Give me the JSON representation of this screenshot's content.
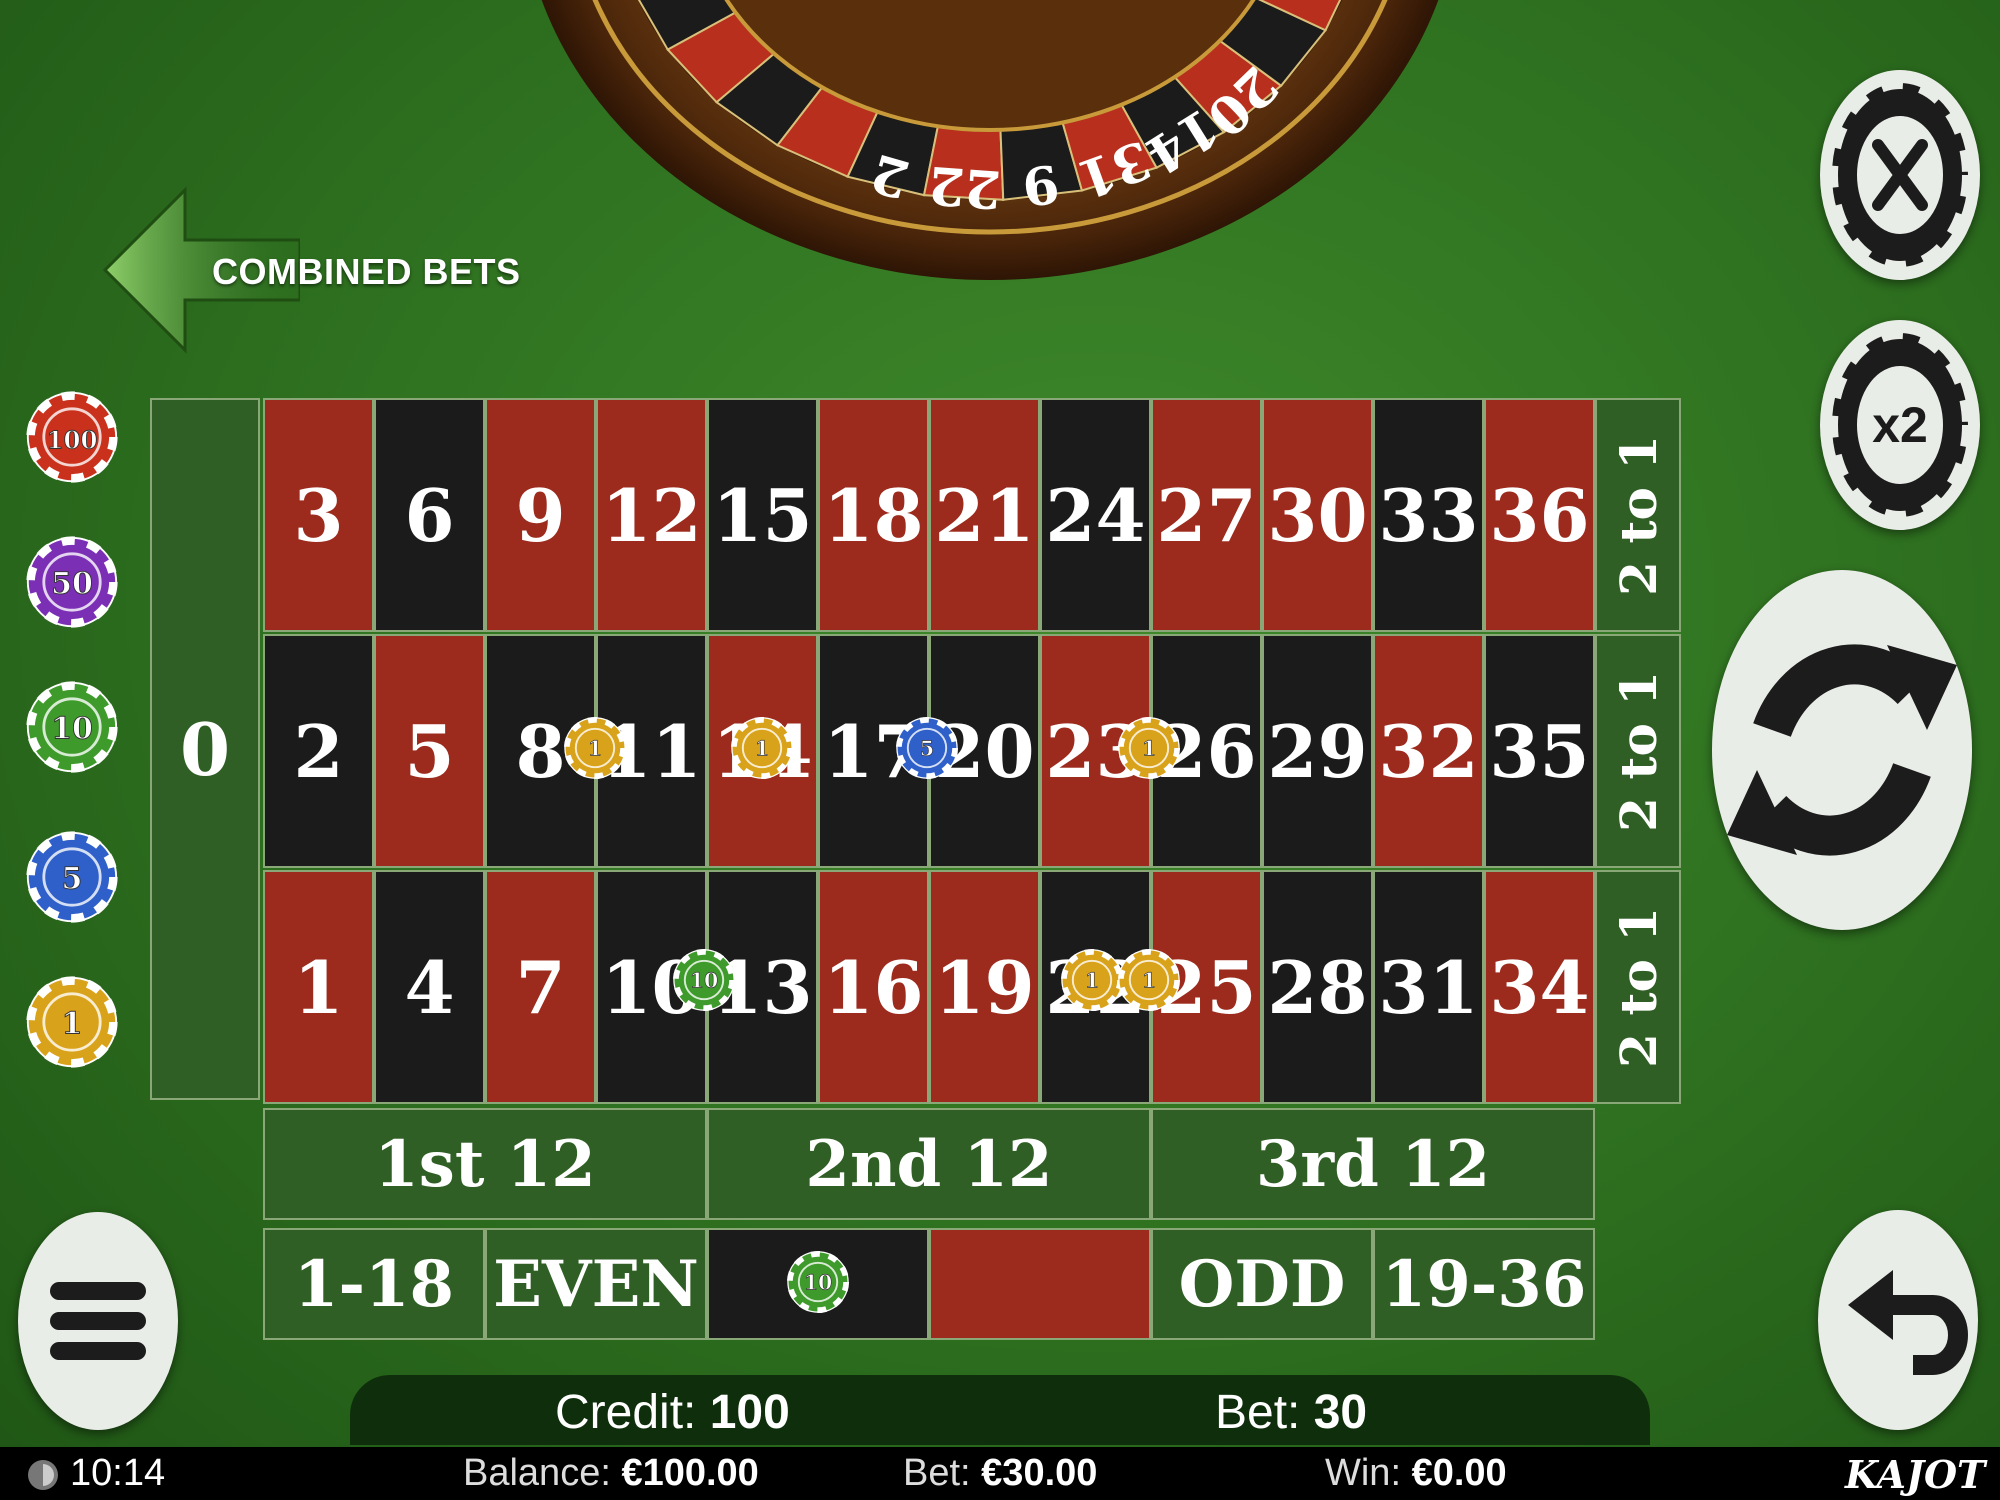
{
  "wheel": {
    "visible_numbers": [
      "2",
      "22",
      "9",
      "31",
      "14",
      "20"
    ]
  },
  "nav": {
    "back_label": "COMBINED BETS",
    "back_icon": "arrow-left-icon"
  },
  "chip_selector": [
    {
      "value": "100",
      "color": "#c9311c"
    },
    {
      "value": "50",
      "color": "#7b2fb5"
    },
    {
      "value": "10",
      "color": "#3f9a2c"
    },
    {
      "value": "5",
      "color": "#2f5fc8"
    },
    {
      "value": "1",
      "color": "#d9a21b"
    }
  ],
  "board": {
    "zero": "0",
    "rows": [
      [
        {
          "n": "3",
          "c": "red"
        },
        {
          "n": "6",
          "c": "black"
        },
        {
          "n": "9",
          "c": "red"
        },
        {
          "n": "12",
          "c": "red"
        },
        {
          "n": "15",
          "c": "black"
        },
        {
          "n": "18",
          "c": "red"
        },
        {
          "n": "21",
          "c": "red"
        },
        {
          "n": "24",
          "c": "black"
        },
        {
          "n": "27",
          "c": "red"
        },
        {
          "n": "30",
          "c": "red"
        },
        {
          "n": "33",
          "c": "black"
        },
        {
          "n": "36",
          "c": "red"
        }
      ],
      [
        {
          "n": "2",
          "c": "black"
        },
        {
          "n": "5",
          "c": "red"
        },
        {
          "n": "8",
          "c": "black"
        },
        {
          "n": "11",
          "c": "black"
        },
        {
          "n": "14",
          "c": "red"
        },
        {
          "n": "17",
          "c": "black"
        },
        {
          "n": "20",
          "c": "black"
        },
        {
          "n": "23",
          "c": "red"
        },
        {
          "n": "26",
          "c": "black"
        },
        {
          "n": "29",
          "c": "black"
        },
        {
          "n": "32",
          "c": "red"
        },
        {
          "n": "35",
          "c": "black"
        }
      ],
      [
        {
          "n": "1",
          "c": "red"
        },
        {
          "n": "4",
          "c": "black"
        },
        {
          "n": "7",
          "c": "red"
        },
        {
          "n": "10",
          "c": "black"
        },
        {
          "n": "13",
          "c": "black"
        },
        {
          "n": "16",
          "c": "red"
        },
        {
          "n": "19",
          "c": "red"
        },
        {
          "n": "22",
          "c": "black"
        },
        {
          "n": "25",
          "c": "red"
        },
        {
          "n": "28",
          "c": "black"
        },
        {
          "n": "31",
          "c": "black"
        },
        {
          "n": "34",
          "c": "red"
        }
      ]
    ],
    "column_bets": [
      "2 to 1",
      "2 to 1",
      "2 to 1"
    ],
    "dozens": [
      "1st 12",
      "2nd 12",
      "3rd 12"
    ],
    "even_money": [
      {
        "label": "1-18",
        "kind": "text"
      },
      {
        "label": "EVEN",
        "kind": "text"
      },
      {
        "label": "",
        "kind": "black"
      },
      {
        "label": "",
        "kind": "red"
      },
      {
        "label": "ODD",
        "kind": "text"
      },
      {
        "label": "19-36",
        "kind": "text"
      }
    ]
  },
  "placed_chips": [
    {
      "value": "1",
      "color": "#d9a21b",
      "bet": "split 8/11"
    },
    {
      "value": "1",
      "color": "#d9a21b",
      "bet": "14"
    },
    {
      "value": "5",
      "color": "#2f5fc8",
      "bet": "split 17/20"
    },
    {
      "value": "1",
      "color": "#d9a21b",
      "bet": "split 23/26"
    },
    {
      "value": "10",
      "color": "#3f9a2c",
      "bet": "split 10/13"
    },
    {
      "value": "1",
      "color": "#d9a21b",
      "bet": "22"
    },
    {
      "value": "1",
      "color": "#d9a21b",
      "bet": "split 22/25"
    },
    {
      "value": "10",
      "color": "#3f9a2c",
      "bet": "black"
    }
  ],
  "controls": {
    "clear_icon": "clear-bets-icon",
    "double_icon": "double-bets-icon",
    "double_label": "x2",
    "spin_icon": "spin-icon",
    "menu_icon": "menu-icon",
    "undo_icon": "undo-icon"
  },
  "credit_bar": {
    "credit_label": "Credit:",
    "credit_value": "100",
    "bet_label": "Bet:",
    "bet_value": "30"
  },
  "status_bar": {
    "clock_icon": "clock-icon",
    "time": "10:14",
    "balance_label": "Balance:",
    "balance_value": "€100.00",
    "bet_label": "Bet:",
    "bet_value": "€30.00",
    "win_label": "Win:",
    "win_value": "€0.00",
    "brand": "KAJOT"
  }
}
